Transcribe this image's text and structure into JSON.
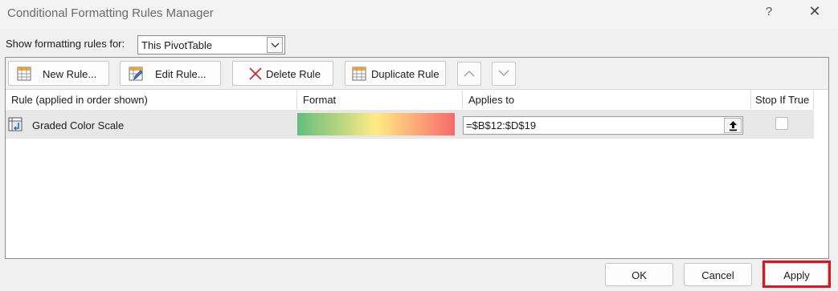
{
  "window": {
    "title": "Conditional Formatting Rules Manager",
    "help": "?",
    "close": "✕"
  },
  "show_rules": {
    "label": "Show formatting rules for:",
    "selected": "This PivotTable"
  },
  "toolbar": {
    "new_rule": "New Rule...",
    "edit_rule": "Edit Rule...",
    "delete_rule": "Delete Rule",
    "duplicate_rule": "Duplicate Rule"
  },
  "columns": {
    "rule": "Rule (applied in order shown)",
    "format": "Format",
    "applies_to": "Applies to",
    "stop_if_true": "Stop If True"
  },
  "rules": [
    {
      "name": "Graded Color Scale",
      "format_colors": [
        "#63be7b",
        "#ffeb84",
        "#f8696b"
      ],
      "applies_to": "=$B$12:$D$19",
      "stop_if_true": false
    }
  ],
  "footer": {
    "ok": "OK",
    "cancel": "Cancel",
    "apply": "Apply",
    "highlight_color": "#e0141e"
  }
}
